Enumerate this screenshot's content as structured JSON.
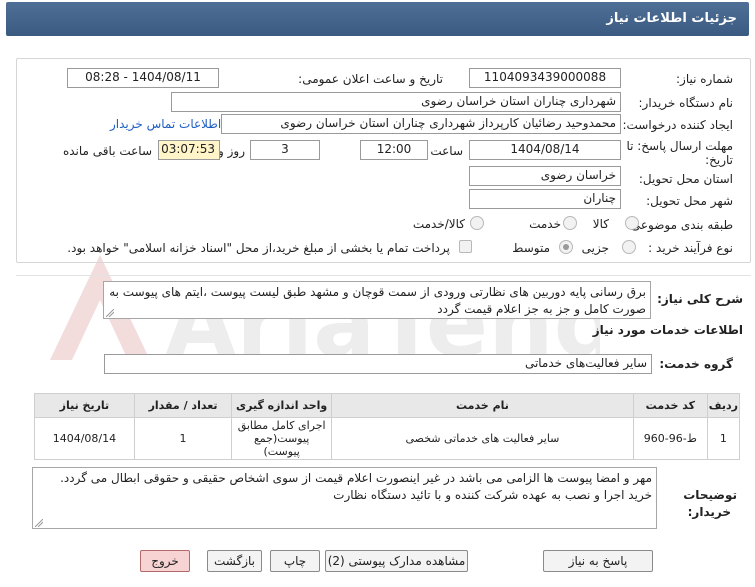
{
  "header": {
    "title": "جزئیات اطلاعات نیاز"
  },
  "form": {
    "need_number_label": "شماره نیاز:",
    "need_number": "1104093439000088",
    "announce_label": "تاریخ و ساعت اعلان عمومی:",
    "announce_value": "1404/08/11 - 08:28",
    "buyer_org_label": "نام دستگاه خریدار:",
    "buyer_org": "شهرداری چناران استان خراسان رضوی",
    "creator_label": "ایجاد کننده درخواست:",
    "creator": "محمدوحید رضائیان کارپرداز شهرداری چناران استان خراسان رضوی",
    "contact_link": "اطلاعات تماس خریدار",
    "deadline_label_1": "مهلت ارسال پاسخ: تا",
    "deadline_label_2": "تاریخ:",
    "deadline_date": "1404/08/14",
    "time_label": "ساعت",
    "deadline_time": "12:00",
    "days_value": "3",
    "days_label": "روز و",
    "remaining_value": "03:07:53",
    "remaining_label": "ساعت باقی مانده",
    "province_label": "استان محل تحویل:",
    "province": "خراسان رضوی",
    "city_label": "شهر محل تحویل:",
    "city": "چناران",
    "category_label": "طبقه بندی موضوعی:",
    "category_options": [
      "کالا",
      "خدمت",
      "کالا/خدمت"
    ],
    "process_label": "نوع فرآیند خرید :",
    "process_options": [
      "جزیی",
      "متوسط"
    ],
    "payment_note": "پرداخت تمام یا بخشی از مبلغ خرید،از محل \"اسناد خزانه اسلامی\" خواهد بود."
  },
  "description": {
    "label": "شرح کلی نیاز:",
    "text": "برق رسانی پایه دوربین های نظارتی ورودی از سمت قوچان و مشهد طبق لیست پیوست ،ایتم های پیوست به صورت کامل و جز به جز اعلام قیمت گردد"
  },
  "services": {
    "section_title": "اطلاعات خدمات مورد نیاز",
    "group_label": "گروه خدمت:",
    "group_value": "سایر فعالیت‌های خدماتی",
    "columns": [
      "ردیف",
      "کد خدمت",
      "نام خدمت",
      "واحد اندازه گیری",
      "تعداد / مقدار",
      "تاریخ نیاز"
    ],
    "rows": [
      {
        "index": "1",
        "code": "ط-96-960",
        "name": "سایر فعالیت های خدماتی شخصی",
        "unit": "اجرای کامل مطابق پیوست(جمع پیوست)",
        "qty": "1",
        "date": "1404/08/14"
      }
    ]
  },
  "buyer_notes": {
    "label_1": "توضیحات",
    "label_2": "خریدار:",
    "text": "مهر و امضا پیوست ها الزامی می باشد در غیر اینصورت اعلام قیمت از سوی اشخاص حقیقی و حقوقی ابطال می گردد. خرید اجرا و نصب به عهده شرکت کننده و با تائید دستگاه نظارت"
  },
  "buttons": {
    "reply": "پاسخ به نیاز",
    "attachments": "مشاهده مدارک پیوستی (2)",
    "print": "چاپ",
    "back": "بازگشت",
    "exit": "خروج"
  },
  "watermark": {
    "text": "AriaTender.net"
  },
  "colors": {
    "header": "#3f5f88",
    "link": "#1f5fc2",
    "remaining_bg": "#fff5c8",
    "exit_bg": "#f8d3d3"
  }
}
